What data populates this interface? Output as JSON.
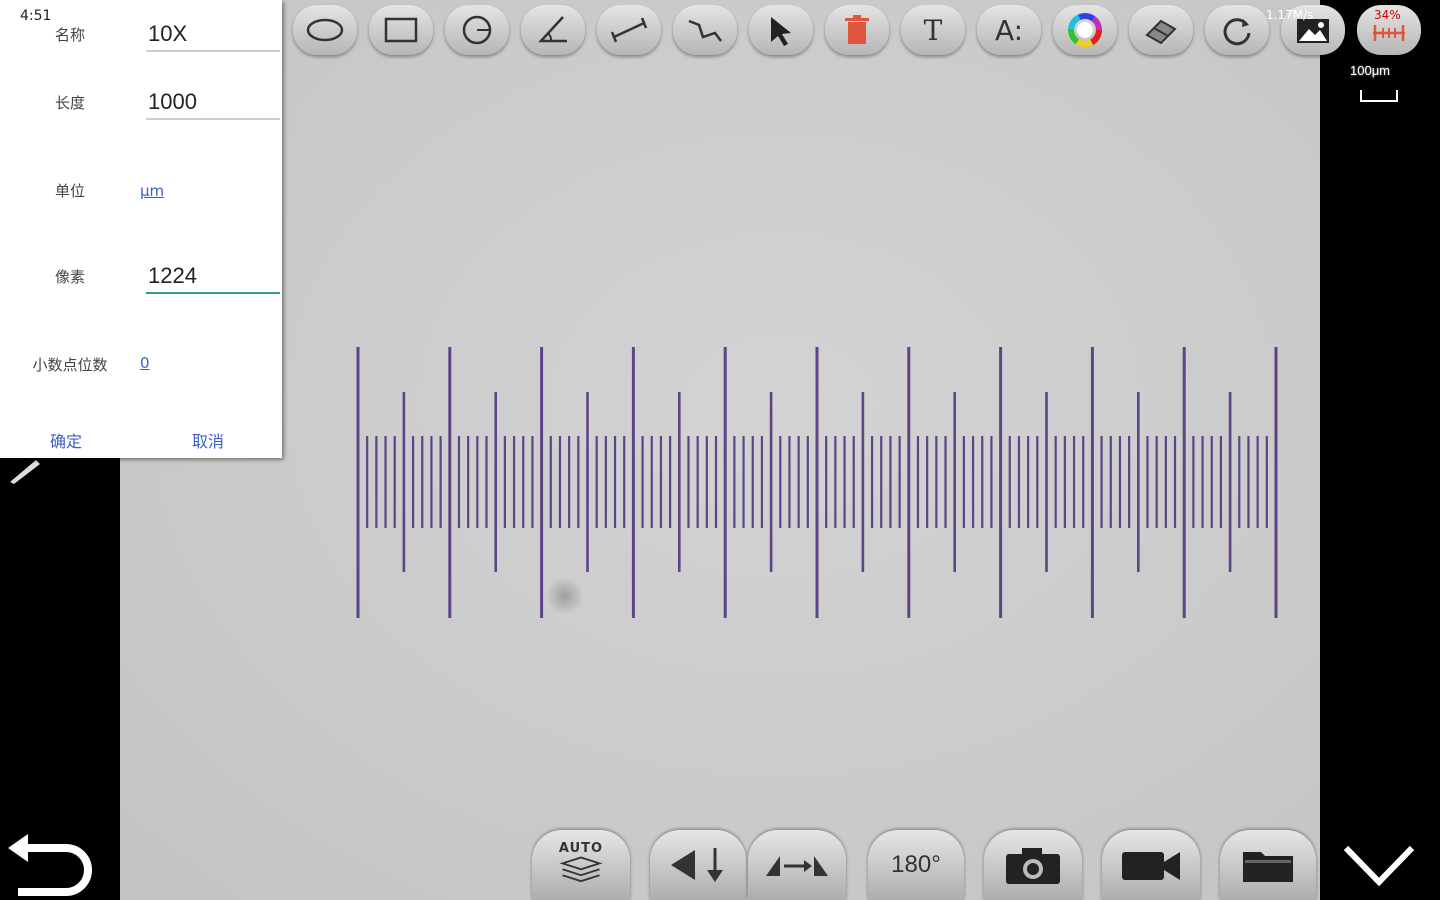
{
  "status_bar": {
    "time": "4:51",
    "info": "1.17M/s",
    "battery": "34%"
  },
  "calibration_dialog": {
    "name_label": "名称",
    "name_value": "10X",
    "length_label": "长度",
    "length_value": "1000",
    "unit_label": "单位",
    "unit_value": "μm",
    "pixels_label": "像素",
    "pixels_value": "1224",
    "decimals_label": "小数点位数",
    "decimals_value": "0",
    "confirm_label": "确定",
    "cancel_label": "取消"
  },
  "scale_bar": {
    "label": "100μm"
  },
  "toolbar": {
    "tools": [
      "ellipse-tool-icon",
      "rectangle-tool-icon",
      "circle-tool-icon",
      "angle-tool-icon",
      "line-measure-tool-icon",
      "polyline-tool-icon",
      "select-arrow-icon",
      "delete-trash-icon",
      "text-tool-icon",
      "font-size-icon",
      "color-picker-icon",
      "eraser-icon",
      "refresh-icon",
      "image-icon",
      "calibration-ruler-icon"
    ],
    "text_tool_glyph": "T",
    "font_tool_glyph": "A:"
  },
  "bottom_bar": {
    "auto_label": "AUTO",
    "rotate_label": "180°"
  },
  "colors": {
    "dialog_accent": "#2e9c8a",
    "link": "#3b5fc8",
    "ruler_line": "#4a2a7a",
    "delete_icon": "#e0553c"
  }
}
